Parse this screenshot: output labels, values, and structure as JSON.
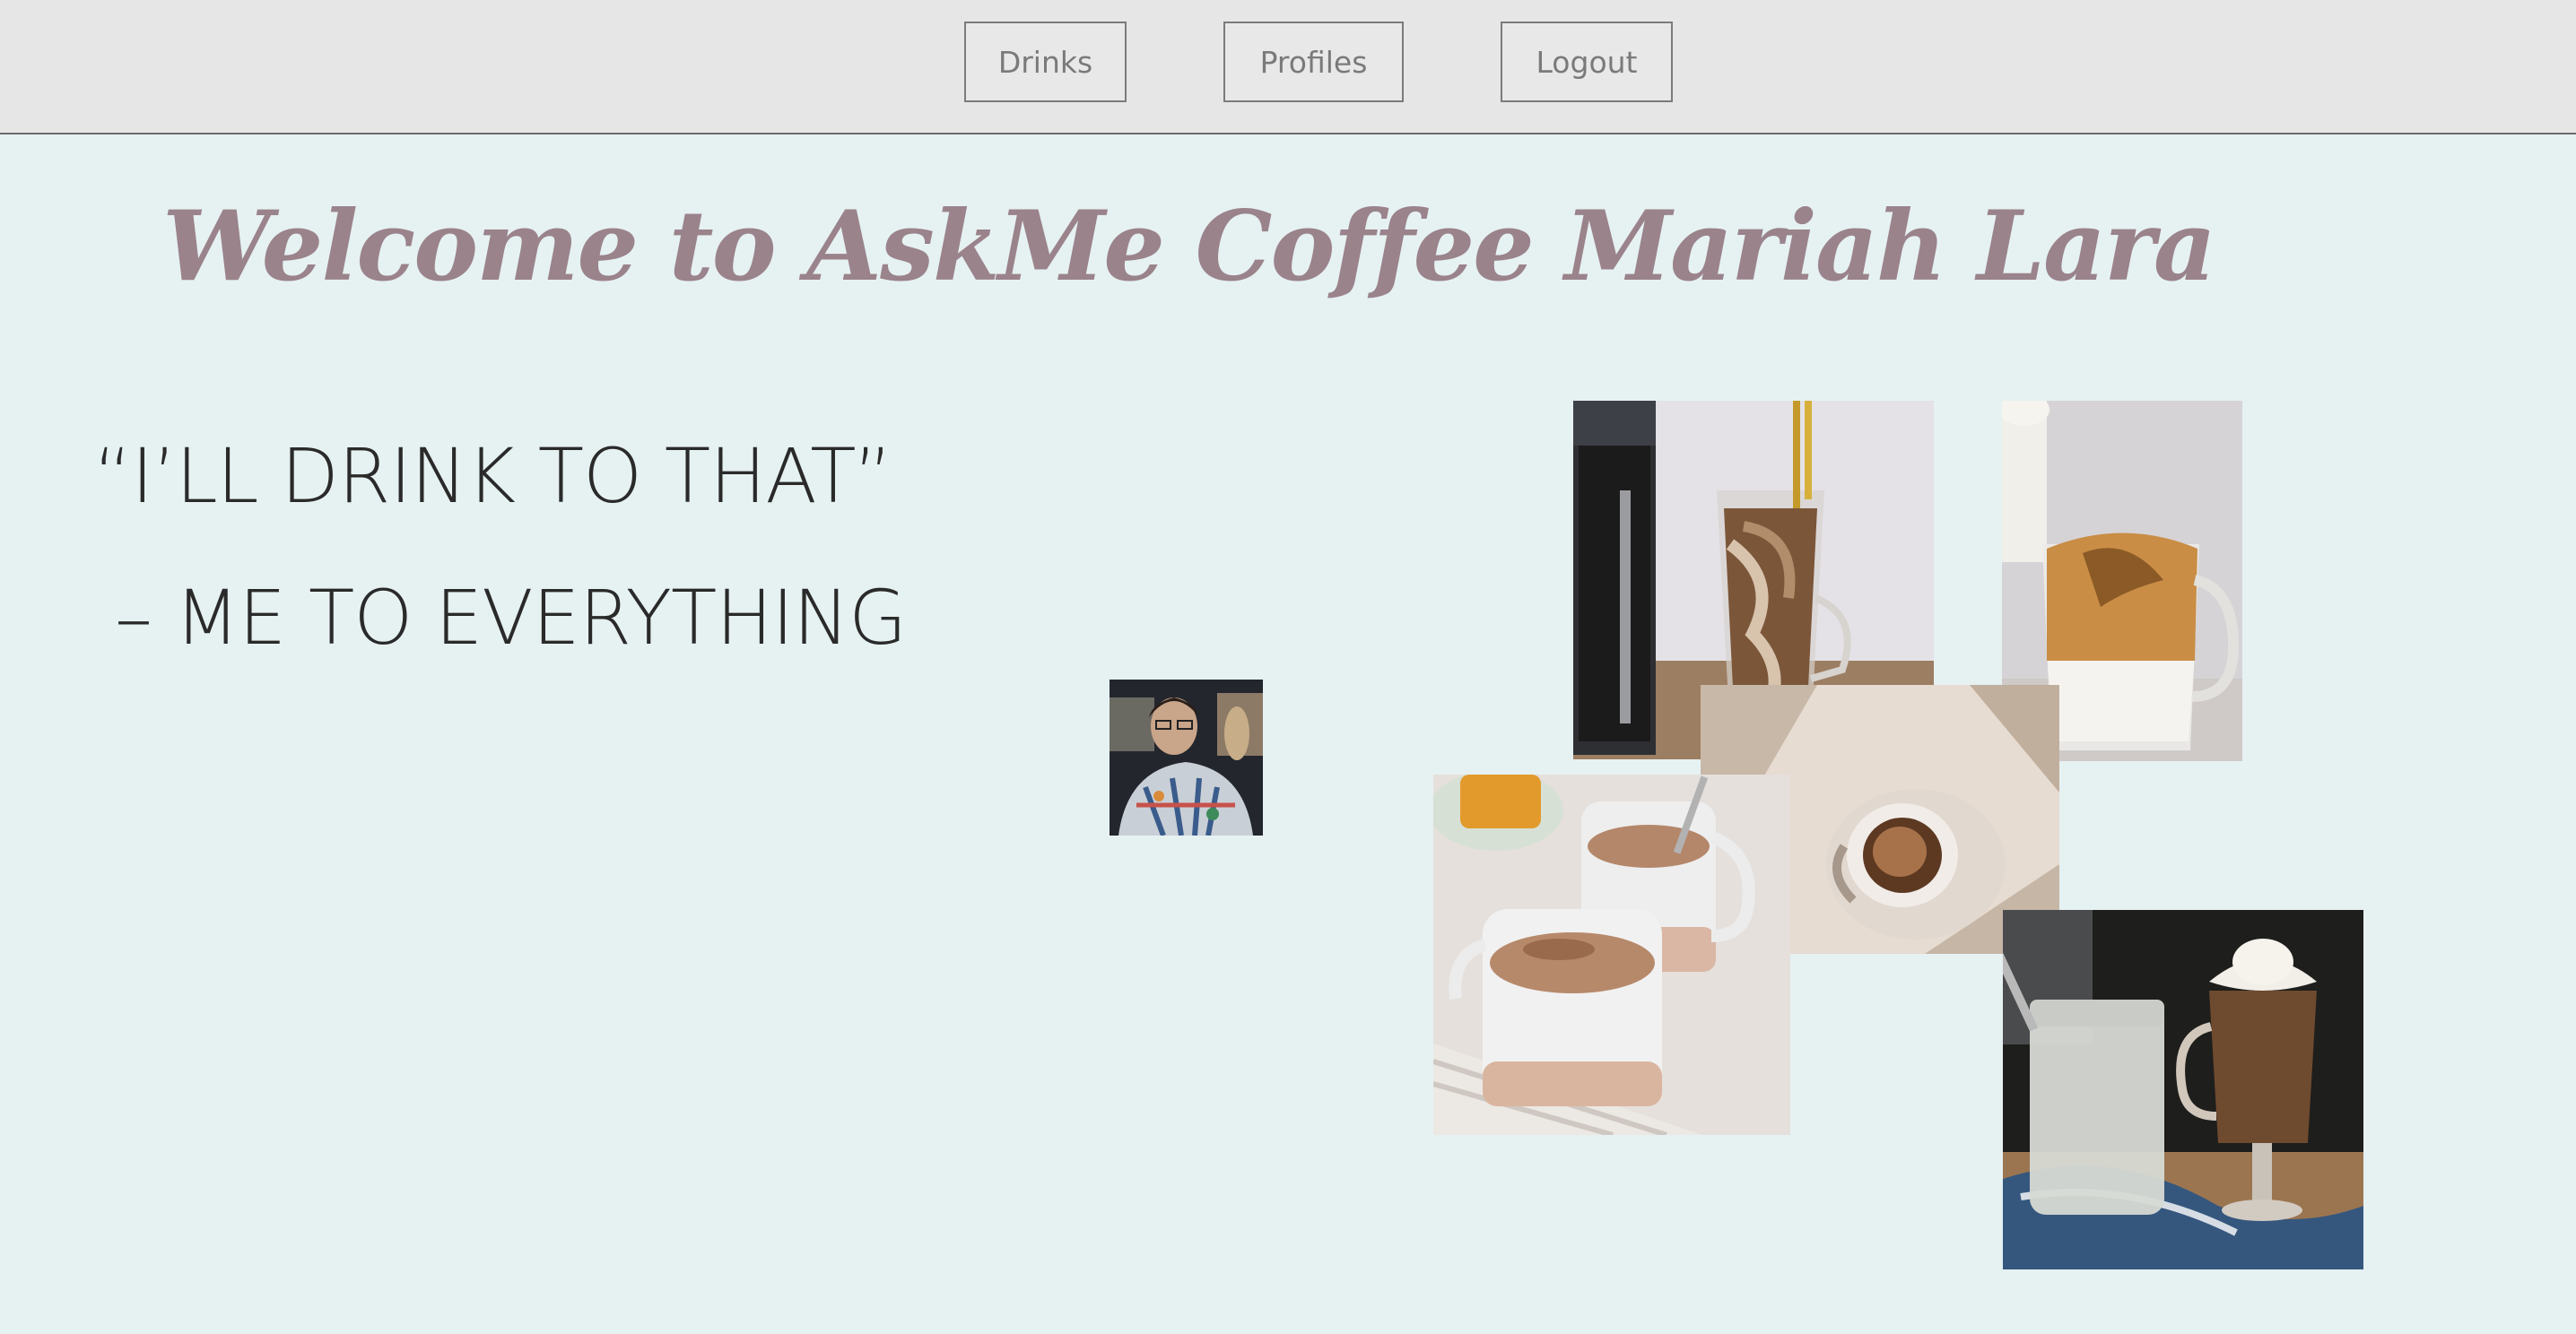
{
  "nav": {
    "drinks_label": "Drinks",
    "profiles_label": "Profiles",
    "logout_label": "Logout"
  },
  "welcome": {
    "title": "Welcome to AskMe Coffee Mariah Lara"
  },
  "quote": {
    "line1": "“I’LL DRINK TO THAT”",
    "line2": "– ME TO EVERYTHING"
  },
  "colors": {
    "background": "#e6f1f2",
    "nav_background": "#e6e6e6",
    "title": "#9a838b",
    "quote_text": "#2a2a2a"
  },
  "images": {
    "avatar": "profile-photo",
    "collage": [
      "iced-coffee-photo",
      "dalgona-coffee-photo",
      "espresso-cup-photo",
      "milk-tea-mugs-photo",
      "frappe-photo"
    ]
  }
}
